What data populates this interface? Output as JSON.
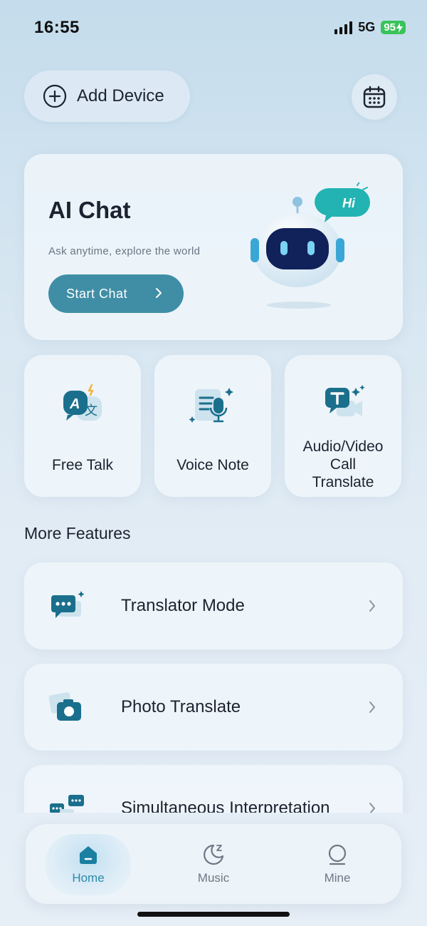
{
  "status": {
    "time": "16:55",
    "network": "5G",
    "battery": "95"
  },
  "header": {
    "add_device_label": "Add Device"
  },
  "ai_chat": {
    "title": "AI Chat",
    "subtitle": "Ask anytime, explore the world",
    "button_label": "Start Chat",
    "bubble_text": "Hi"
  },
  "features": [
    {
      "label": "Free Talk"
    },
    {
      "label": "Voice Note"
    },
    {
      "label_lines": [
        "Audio/Video",
        "Call",
        "Translate"
      ]
    }
  ],
  "more_features": {
    "title": "More Features",
    "items": [
      {
        "label": "Translator Mode"
      },
      {
        "label": "Photo Translate"
      },
      {
        "label": "Simultaneous Interpretation"
      }
    ]
  },
  "tabs": [
    {
      "label": "Home",
      "active": true
    },
    {
      "label": "Music",
      "active": false
    },
    {
      "label": "Mine",
      "active": false
    }
  ],
  "colors": {
    "accent": "#3f8ea6",
    "accent_dark": "#1a6f8c",
    "battery": "#39c35a"
  }
}
